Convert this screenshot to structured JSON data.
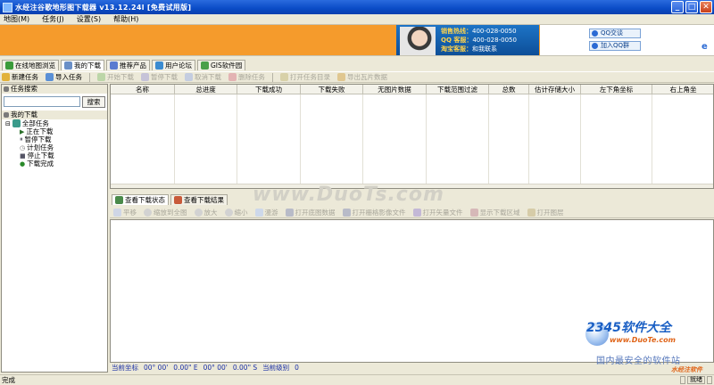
{
  "window": {
    "title": "水经注谷歌地形图下载器 v13.12.24l [免费试用版]"
  },
  "menu": [
    "地图(M)",
    "任务(J)",
    "设置(S)",
    "帮助(H)"
  ],
  "banner": {
    "sales_label": "销售热线：",
    "sales_value": "400-028-0050",
    "qq_label": "QQ 客服：",
    "qq_value": "400-028-0050",
    "taobao_label": "淘宝客服：",
    "taobao_value": "和我联系",
    "qq_chat": "QQ交谈",
    "qq_group": "加入QQ群"
  },
  "tabs": [
    "在线地图浏览",
    "我的下载",
    "推荐产品",
    "用户论坛",
    "GIS软件园"
  ],
  "toolbar": [
    "新建任务",
    "导入任务",
    "开始下载",
    "暂停下载",
    "取消下载",
    "删除任务",
    "打开任务目录",
    "导出瓦片数据"
  ],
  "left_panel": {
    "search_title": "任务搜索",
    "search_button": "搜索",
    "downloads_title": "我的下载",
    "tree": {
      "root": "全部任务",
      "children": [
        "正在下载",
        "暂停下载",
        "计划任务",
        "停止下载",
        "下载完成"
      ]
    }
  },
  "table": {
    "columns": [
      "名称",
      "总进度",
      "下载成功",
      "下载失败",
      "无图片数据",
      "下载范围过滤",
      "总数",
      "估计存储大小",
      "左下角坐标",
      "右上角坐"
    ]
  },
  "watermark": "www.DuoTs.com",
  "bottom_tabs": [
    "查看下载状态",
    "查看下载结果"
  ],
  "bottom_toolbar": [
    "平移",
    "缩放到全图",
    "放大",
    "缩小",
    "漫游",
    "打开底图数据",
    "打开栅格影像文件",
    "打开矢量文件",
    "显示下载区域",
    "打开图层"
  ],
  "coords": {
    "label": "当前坐标",
    "lon": "00° 00'",
    "lat1": "0.00\" E",
    "lat2": "00° 00'",
    "lat3": "0.00\" S",
    "level_label": "当前级别",
    "level": "0"
  },
  "status": {
    "text": "完成",
    "cells": [
      "",
      "就绪",
      ""
    ]
  },
  "overlay": {
    "logo": "2345软件大全",
    "site": "www.DuoTe.com",
    "slogan": "国内最安全的软件站",
    "brand": "水经注软件"
  }
}
